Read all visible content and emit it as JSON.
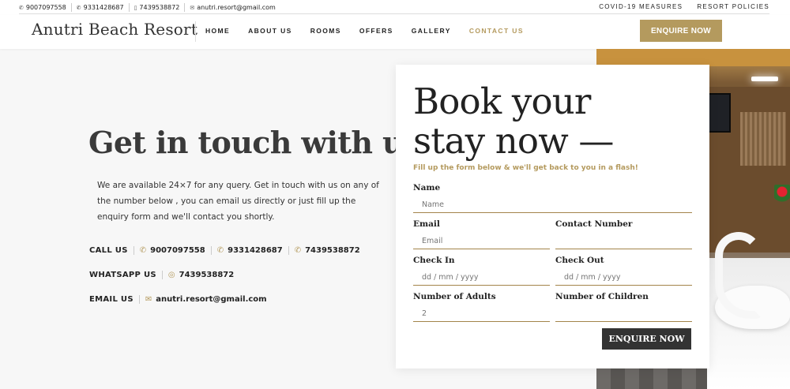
{
  "topbar": {
    "phones": [
      "9007097558",
      "9331428687",
      "7439538872"
    ],
    "email": "anutri.resort@gmail.com",
    "links": [
      "COVID-19 MEASURES",
      "RESORT POLICIES"
    ]
  },
  "header": {
    "logo": "Anutri Beach Resort",
    "nav": [
      "HOME",
      "ABOUT US",
      "ROOMS",
      "OFFERS",
      "GALLERY",
      "CONTACT US"
    ],
    "active_nav": "CONTACT US",
    "enquire_label": "ENQUIRE NOW"
  },
  "contact": {
    "heading": "Get in touch with us",
    "description": "We are available 24×7 for any query. Get in touch with us on any of the number below , you can email us directly or just fill up the enquiry form and we'll contact you shortly.",
    "call_label": "CALL US",
    "call_numbers": [
      "9007097558",
      "9331428687",
      "7439538872"
    ],
    "whatsapp_label": "WHATSAPP US",
    "whatsapp_number": "7439538872",
    "email_label": "EMAIL US",
    "email": "anutri.resort@gmail.com"
  },
  "booking": {
    "title_line1": "Book your",
    "title_line2": "stay now —",
    "subtitle": "Fill up the form below & we'll get back to you in a flash!",
    "name_label": "Name",
    "name_placeholder": "Name",
    "email_label": "Email",
    "email_placeholder": "Email",
    "contact_label": "Contact Number",
    "contact_placeholder": "",
    "checkin_label": "Check In",
    "checkin_placeholder": "dd / mm / yyyy",
    "checkout_label": "Check Out",
    "checkout_placeholder": "dd / mm / yyyy",
    "adults_label": "Number of Adults",
    "adults_value": "2",
    "children_label": "Number of Children",
    "children_value": "",
    "submit_label": "ENQUIRE NOW"
  },
  "colors": {
    "accent": "#b49a5e",
    "dark_button": "#333333"
  }
}
